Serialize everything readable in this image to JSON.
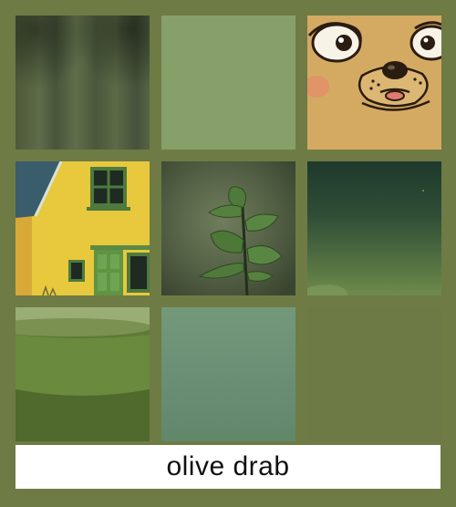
{
  "caption": {
    "text": "olive drab"
  },
  "colors": {
    "background": "#6e7b45",
    "caption_background": "#ffffff",
    "caption_text": "#111111"
  },
  "tiles": [
    {
      "name": "fabric-tile",
      "description_icon": "fabric-image"
    },
    {
      "name": "sage-swatch-tile",
      "description_icon": "color-swatch"
    },
    {
      "name": "cartoon-dog-tile",
      "description_icon": "dog-face-image"
    },
    {
      "name": "yellow-house-tile",
      "description_icon": "house-image"
    },
    {
      "name": "plant-tile",
      "description_icon": "leaf-plant-image"
    },
    {
      "name": "dark-green-gradient-tile",
      "description_icon": "gradient-image"
    },
    {
      "name": "green-bowl-tile",
      "description_icon": "bowl-image"
    },
    {
      "name": "seafoam-swatch-tile",
      "description_icon": "color-swatch"
    },
    {
      "name": "olive-swatch-tile",
      "description_icon": "color-swatch"
    }
  ]
}
